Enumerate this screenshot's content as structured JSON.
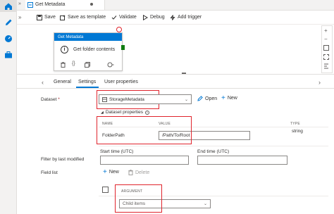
{
  "tab": {
    "title": "Get Metadata"
  },
  "toolbar": {
    "save": "Save",
    "save_as_template": "Save as template",
    "validate": "Validate",
    "debug": "Debug",
    "add_trigger": "Add trigger"
  },
  "activity": {
    "header": "Get Metadata",
    "body": "Get folder contents"
  },
  "props_tabs": {
    "general": "General",
    "settings": "Settings",
    "user_properties": "User properties"
  },
  "dataset": {
    "label": "Dataset",
    "required_mark": "*",
    "selected": "StorageMetadata",
    "open": "Open",
    "new": "New",
    "properties_toggle": "Dataset properties",
    "columns": {
      "name": "NAME",
      "value": "VALUE",
      "type": "TYPE"
    },
    "row": {
      "name": "FolderPath",
      "value": "/Path/To/Root",
      "type": "string"
    }
  },
  "filter": {
    "label": "Filter by last modified",
    "start": "Start time (UTC)",
    "end": "End time (UTC)"
  },
  "fieldlist": {
    "label": "Field list",
    "new": "New",
    "delete": "Delete",
    "argument_header": "ARGUMENT",
    "argument_value": "Child items"
  },
  "colors": {
    "accent": "#0078d4",
    "highlight": "#e0242c"
  }
}
